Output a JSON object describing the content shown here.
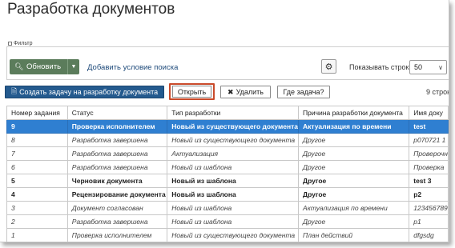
{
  "page": {
    "title": "Разработка документов"
  },
  "filter": {
    "legend": "Фильтр",
    "refresh_label": "Обновить",
    "add_condition_label": "Добавить условие поиска",
    "rows_label": "Показывать строк",
    "rows_value": "50"
  },
  "toolbar": {
    "create_label": "Создать задачу на разработку документа",
    "open_label": "Открыть",
    "delete_label": "Удалить",
    "where_label": "Где задача?",
    "count_label": "9 строк"
  },
  "table": {
    "columns": [
      "Номер задания",
      "Статус",
      "Тип разработки",
      "Причина разработки документа",
      "Имя доку"
    ],
    "rows": [
      {
        "style": "selected",
        "cells": [
          "9",
          "Проверка исполнителем",
          "Новый из существующего документа",
          "Актуализация по времени",
          "test"
        ]
      },
      {
        "style": "italic",
        "cells": [
          "8",
          "Разработка завершена",
          "Новый из существующего документа",
          "Другое",
          "p070721 1"
        ]
      },
      {
        "style": "italic",
        "cells": [
          "7",
          "Разработка завершена",
          "Актуализация",
          "Другое",
          "Проверочн"
        ]
      },
      {
        "style": "italic",
        "cells": [
          "6",
          "Разработка завершена",
          "Новый из шаблона",
          "Другое",
          "Проверка"
        ]
      },
      {
        "style": "bold",
        "cells": [
          "5",
          "Черновик документа",
          "Новый из шаблона",
          "Другое",
          "test 3"
        ]
      },
      {
        "style": "bold",
        "cells": [
          "4",
          "Рецензирование документа",
          "Новый из шаблона",
          "Другое",
          "p2"
        ]
      },
      {
        "style": "italic",
        "cells": [
          "3",
          "Документ согласован",
          "Новый из шаблона",
          "Актуализация по времени",
          "123456789"
        ]
      },
      {
        "style": "italic",
        "cells": [
          "2",
          "Разработка завершена",
          "Новый из шаблона",
          "Другое",
          "p1"
        ]
      },
      {
        "style": "italic",
        "cells": [
          "1",
          "Проверка исполнителем",
          "Новый из существующего документа",
          "План действий",
          "dfgsdg"
        ]
      }
    ]
  }
}
